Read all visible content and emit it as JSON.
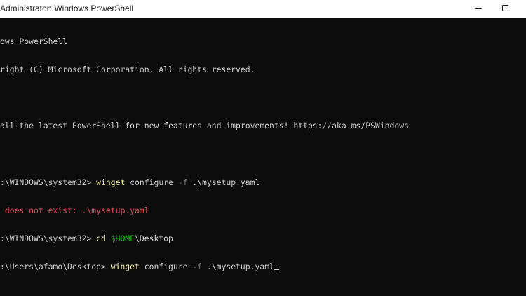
{
  "window": {
    "title": "Administrator: Windows PowerShell"
  },
  "console": {
    "header_line1": "ows PowerShell",
    "header_line2": "right (C) Microsoft Corporation. All rights reserved.",
    "header_line3": "all the latest PowerShell for new features and improvements! https://aka.ms/PSWindows",
    "cmd1": {
      "prompt": ":\\WINDOWS\\system32> ",
      "command": "winget",
      "args1": " configure ",
      "param": "-f",
      "args2": " .\\mysetup.yaml"
    },
    "error_line": " does not exist: .\\mysetup.yaml",
    "cmd2": {
      "prompt": ":\\WINDOWS\\system32> ",
      "command": "cd",
      "space": " ",
      "variable": "$HOME",
      "rest": "\\Desktop"
    },
    "cmd3": {
      "prompt": ":\\Users\\afamo\\Desktop> ",
      "command": "winget",
      "args1": " configure ",
      "param": "-f",
      "args2": " .\\mysetup.yaml"
    }
  },
  "colors": {
    "background": "#0c0c0c",
    "text": "#cccccc",
    "command": "#f9f1a5",
    "parameter": "#767676",
    "variable": "#16c60c",
    "error": "#e74856",
    "titlebar": "#ffffff"
  },
  "icons": {
    "minimize": "minimize-icon",
    "maximize": "maximize-icon"
  }
}
